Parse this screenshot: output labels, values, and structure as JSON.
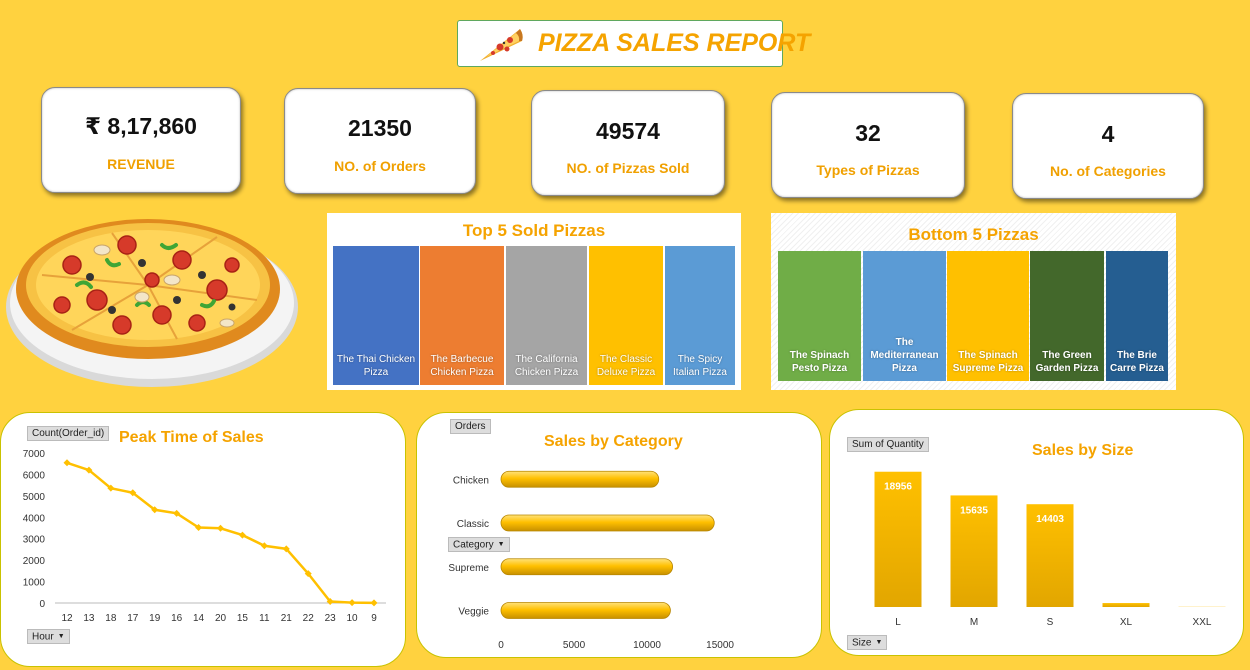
{
  "header": {
    "title": "PIZZA SALES REPORT",
    "icon": "pizza-slice-icon"
  },
  "kpis": [
    {
      "value": "₹ 8,17,860",
      "label": "REVENUE"
    },
    {
      "value": "21350",
      "label": "NO. of Orders"
    },
    {
      "value": "49574",
      "label": "NO. of Pizzas Sold"
    },
    {
      "value": "32",
      "label": "Types of Pizzas"
    },
    {
      "value": "4",
      "label": "No. of Categories"
    }
  ],
  "hero": {
    "icon": "whole-pizza-icon"
  },
  "top5": {
    "title": "Top 5 Sold Pizzas",
    "items": [
      {
        "label": "The Thai Chicken Pizza",
        "color": "#4472C4"
      },
      {
        "label": "The Barbecue Chicken Pizza",
        "color": "#ED7D31"
      },
      {
        "label": "The California Chicken Pizza",
        "color": "#A5A5A5"
      },
      {
        "label": "The Classic Deluxe Pizza",
        "color": "#FFC000"
      },
      {
        "label": "The Spicy Italian Pizza",
        "color": "#5B9BD5"
      }
    ]
  },
  "bottom5": {
    "title": "Bottom 5 Pizzas",
    "items": [
      {
        "label": "The Spinach Pesto Pizza",
        "color": "#70AD47"
      },
      {
        "label": "The Mediterranean Pizza",
        "color": "#5B9BD5"
      },
      {
        "label": "The Spinach Supreme Pizza",
        "color": "#FFC000"
      },
      {
        "label": "The Green Garden Pizza",
        "color": "#43682B"
      },
      {
        "label": "The Brie Carre Pizza",
        "color": "#255E91"
      }
    ]
  },
  "chart_data": [
    {
      "type": "line",
      "title": "Peak Time of Sales",
      "series_field": "Count(Order_id)",
      "axis_field": "Hour",
      "categories": [
        "12",
        "13",
        "18",
        "17",
        "19",
        "16",
        "14",
        "20",
        "15",
        "11",
        "21",
        "22",
        "23",
        "10",
        "9"
      ],
      "values": [
        6543,
        6203,
        5359,
        5143,
        4350,
        4185,
        3521,
        3487,
        3170,
        2672,
        2528,
        1370,
        68,
        18,
        4
      ],
      "yticks": [
        0,
        1000,
        2000,
        3000,
        4000,
        5000,
        6000,
        7000
      ],
      "ylim": [
        0,
        7000
      ],
      "color": "#FFC000"
    },
    {
      "type": "bar",
      "orientation": "horizontal",
      "title": "Sales by Category",
      "series_field": "Orders",
      "axis_field": "Category",
      "categories": [
        "Chicken",
        "Classic",
        "Supreme",
        "Veggie"
      ],
      "values": [
        10800,
        14600,
        11750,
        11600
      ],
      "xticks": [
        0,
        5000,
        10000,
        15000
      ],
      "xlim": [
        0,
        16500
      ],
      "color": "#FFC000"
    },
    {
      "type": "bar",
      "title": "Sales by Size",
      "series_field": "Sum of Quantity",
      "axis_field": "Size",
      "categories": [
        "L",
        "M",
        "S",
        "XL",
        "XXL"
      ],
      "values": [
        18956,
        15635,
        14403,
        552,
        28
      ],
      "data_labels": [
        "18956",
        "15635",
        "14403",
        "",
        ""
      ],
      "ylim": [
        0,
        22000
      ],
      "color": "#FFC000"
    }
  ]
}
